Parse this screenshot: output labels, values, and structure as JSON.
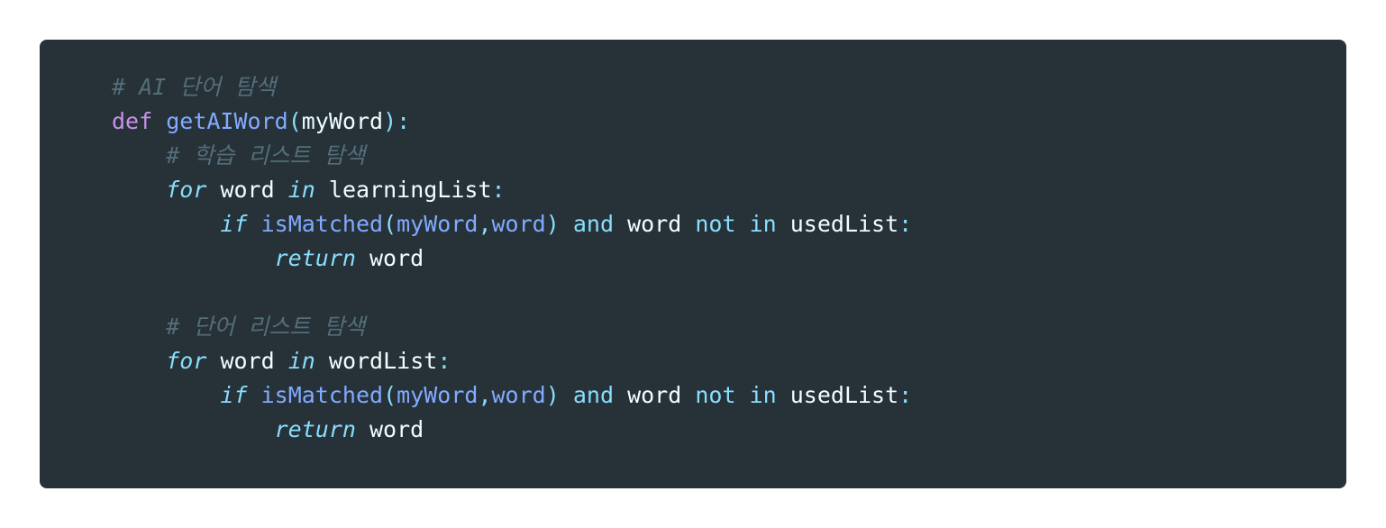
{
  "code": {
    "comment_ai": "# AI 단어 탐색",
    "kw_def": "def",
    "fn_getAIWord": "getAIWord",
    "param_myWord": "myWord",
    "comment_learning": "# 학습 리스트 탐색",
    "kw_for": "for",
    "var_word": "word",
    "kw_in": "in",
    "var_learningList": "learningList",
    "kw_if": "if",
    "fn_isMatched": "isMatched",
    "arg_myWord": "myWord",
    "arg_word": "word",
    "kw_and": "and",
    "kw_not": "not",
    "var_usedList": "usedList",
    "kw_return": "return",
    "comment_wordlist": "# 단어 리스트 탐색",
    "var_wordList": "wordList"
  },
  "colors": {
    "background": "#263238",
    "comment": "#546E7A",
    "keyword_def": "#C792EA",
    "keyword": "#89DDFF",
    "function": "#82AAFF",
    "text": "#EEFFFF"
  }
}
